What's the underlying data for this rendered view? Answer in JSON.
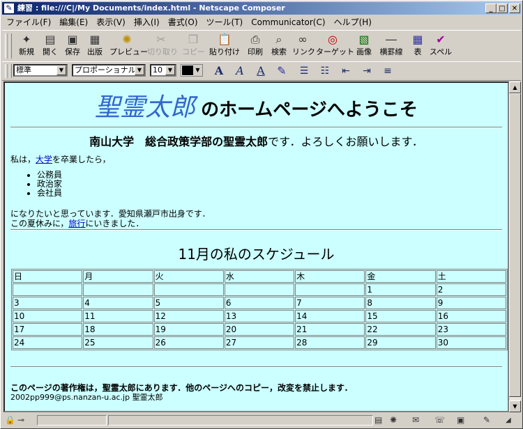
{
  "window": {
    "title": "練習 : file:///C|/My Documents/index.html - Netscape Composer"
  },
  "menu": [
    "ファイル(F)",
    "編集(E)",
    "表示(V)",
    "挿入(I)",
    "書式(O)",
    "ツール(T)",
    "Communicator(C)",
    "ヘルプ(H)"
  ],
  "toolbar": [
    {
      "label": "新規",
      "icon": "new-page-icon"
    },
    {
      "label": "開く",
      "icon": "open-icon"
    },
    {
      "label": "保存",
      "icon": "save-icon"
    },
    {
      "label": "出版",
      "icon": "publish-icon"
    },
    {
      "label": "プレビュー",
      "icon": "preview-icon"
    },
    {
      "label": "切り取り",
      "icon": "cut-icon"
    },
    {
      "label": "コピー",
      "icon": "copy-icon"
    },
    {
      "label": "貼り付け",
      "icon": "paste-icon"
    },
    {
      "label": "印刷",
      "icon": "print-icon"
    },
    {
      "label": "検索",
      "icon": "find-icon"
    },
    {
      "label": "リンク",
      "icon": "link-icon"
    },
    {
      "label": "ターゲット",
      "icon": "target-icon"
    },
    {
      "label": "画像",
      "icon": "image-icon"
    },
    {
      "label": "横罫線",
      "icon": "hrule-icon"
    },
    {
      "label": "表",
      "icon": "table-icon"
    },
    {
      "label": "スペル",
      "icon": "spell-icon"
    }
  ],
  "format": {
    "paragraph_style": "標準",
    "font": "プロポーショナル",
    "size": "10"
  },
  "page": {
    "heading_name": "聖霊太郎",
    "heading_rest": "のホームページへようこそ",
    "intro_bold": "南山大学　総合政策学部の聖霊太郎",
    "intro_rest": "です．よろしくお願いします．",
    "para1_pre": "私は，",
    "para1_link": "大学",
    "para1_post": "を卒業したら，",
    "list": [
      "公務員",
      "政治家",
      "会社員"
    ],
    "para2": "になりたいと思っています．愛知県瀬戸市出身です．",
    "para3_pre": "この夏休みに，",
    "para3_link": "旅行",
    "para3_post": "にいきました．",
    "schedule_title": "11月の私のスケジュール",
    "calendar": {
      "headers": [
        "日",
        "月",
        "火",
        "水",
        "木",
        "金",
        "土"
      ],
      "rows": [
        [
          "",
          "",
          "",
          "",
          "",
          "1",
          "2"
        ],
        [
          "3",
          "4",
          "5",
          "6",
          "7",
          "8",
          "9"
        ],
        [
          "10",
          "11",
          "12",
          "13",
          "14",
          "15",
          "16"
        ],
        [
          "17",
          "18",
          "19",
          "20",
          "21",
          "22",
          "23"
        ],
        [
          "24",
          "25",
          "26",
          "27",
          "28",
          "29",
          "30"
        ]
      ]
    },
    "footer_notice": "このページの著作権は，聖霊太郎にあります．他のページへのコピー，改変を禁止します．",
    "footer_contact": "2002pp999@ps.nanzan-u.ac.jp 聖霊太郎"
  }
}
